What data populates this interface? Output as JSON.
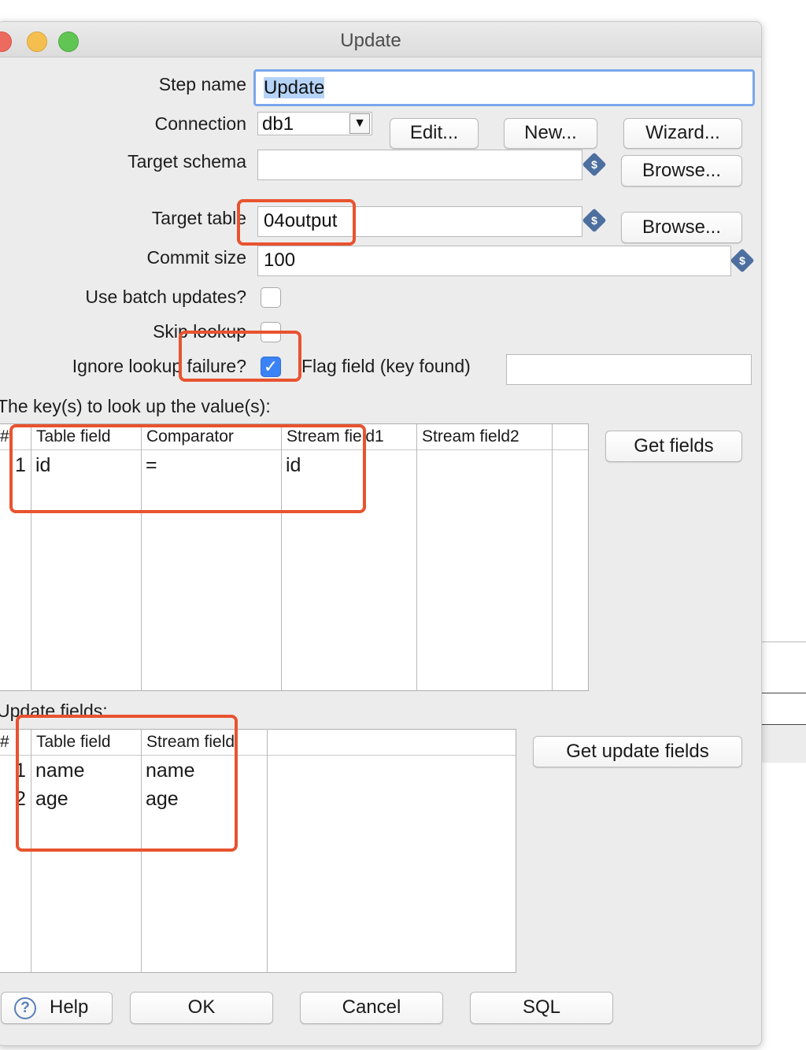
{
  "window": {
    "title": "Update"
  },
  "form": {
    "step_name_label": "Step name",
    "step_name_value": "Update",
    "connection_label": "Connection",
    "connection_value": "db1",
    "edit_button": "Edit...",
    "new_button": "New...",
    "wizard_button": "Wizard...",
    "target_schema_label": "Target schema",
    "target_schema_value": "",
    "browse_button": "Browse...",
    "target_table_label": "Target table",
    "target_table_value": "04output",
    "commit_size_label": "Commit size",
    "commit_size_value": "100",
    "batch_updates_label": "Use batch updates?",
    "batch_updates_checked": false,
    "skip_lookup_label": "Skip lookup",
    "skip_lookup_checked": false,
    "ignore_failure_label": "Ignore lookup failure?",
    "ignore_failure_checked": true,
    "flag_field_label": "Flag field (key found)",
    "flag_field_value": ""
  },
  "keys_section": {
    "title": "The key(s) to look up the value(s):",
    "columns": [
      "#",
      "Table field",
      "Comparator",
      "Stream field1",
      "Stream field2"
    ],
    "rows": [
      {
        "num": "1",
        "table_field": "id",
        "comparator": "=",
        "stream_field1": "id",
        "stream_field2": ""
      }
    ],
    "get_fields_button": "Get fields"
  },
  "update_section": {
    "title": "Update fields:",
    "columns": [
      "#",
      "Table field",
      "Stream field"
    ],
    "rows": [
      {
        "num": "1",
        "table_field": "name",
        "stream_field": "name"
      },
      {
        "num": "2",
        "table_field": "age",
        "stream_field": "age"
      }
    ],
    "get_update_fields_button": "Get update fields"
  },
  "footer": {
    "help_button": "Help",
    "ok_button": "OK",
    "cancel_button": "Cancel",
    "sql_button": "SQL"
  },
  "icons": {
    "variable": "dollar-variable-icon",
    "dropdown": "dropdown-arrow-icon",
    "help": "help-question-icon",
    "check": "checkmark-icon"
  },
  "colors": {
    "highlight": "#e8532f",
    "checkbox_on": "#3b82f6",
    "focus": "#7aa7ea"
  }
}
